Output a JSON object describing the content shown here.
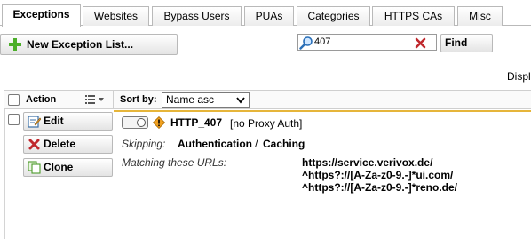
{
  "tabs": [
    {
      "label": "Exceptions",
      "active": true
    },
    {
      "label": "Websites",
      "active": false
    },
    {
      "label": "Bypass Users",
      "active": false
    },
    {
      "label": "PUAs",
      "active": false
    },
    {
      "label": "Categories",
      "active": false
    },
    {
      "label": "HTTPS CAs",
      "active": false
    },
    {
      "label": "Misc",
      "active": false
    }
  ],
  "toolbar": {
    "new_list_label": "New Exception List...",
    "search_value": "407",
    "find_label": "Find",
    "display_label": "Displ"
  },
  "list_header": {
    "action_label": "Action",
    "sort_label": "Sort by:",
    "sort_value": "Name asc"
  },
  "entry": {
    "actions": {
      "edit": "Edit",
      "delete": "Delete",
      "clone": "Clone"
    },
    "name": "HTTP_407",
    "comment": "[no Proxy Auth]",
    "skipping_label": "Skipping:",
    "skipping_value_1": "Authentication",
    "skipping_sep": "/",
    "skipping_value_2": "Caching",
    "matching_label": "Matching these URLs:",
    "urls": [
      "https://service.verivox.de/",
      "^https?://[A-Za-z0-9.-]*ui.com/",
      "^https?://[A-Za-z0-9.-]*reno.de/"
    ]
  },
  "colors": {
    "accent_separator": "#e6b53a",
    "add_icon": "#4caf2a",
    "delete_icon": "#c0282d",
    "warning_icon": "#f0a020"
  }
}
